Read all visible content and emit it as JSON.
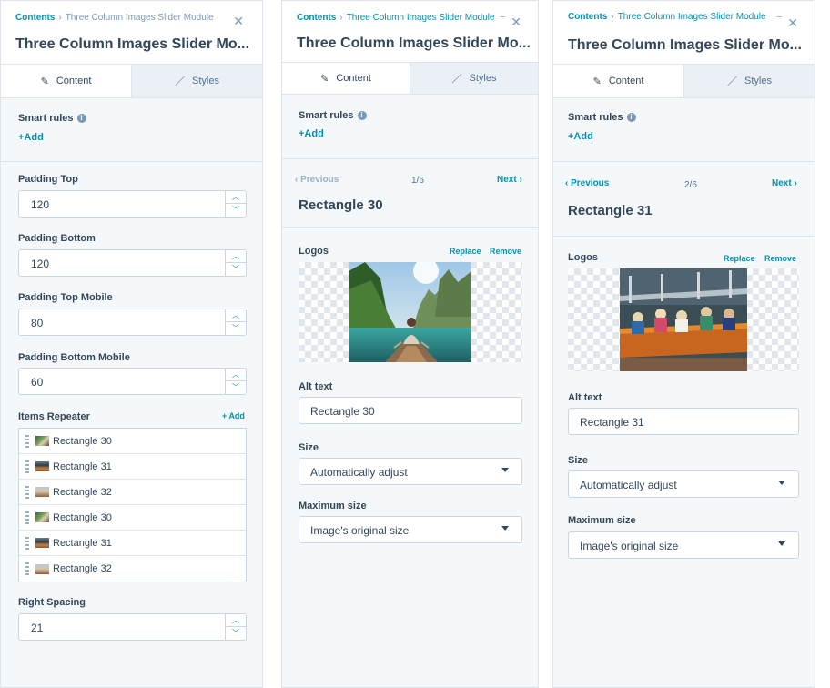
{
  "breadcrumb": {
    "root": "Contents",
    "current": "Three Column Images Slider Module"
  },
  "module_title": "Three Column Images Slider Mo...",
  "tabs": {
    "content": "Content",
    "styles": "Styles"
  },
  "smart_rules": {
    "label": "Smart rules",
    "add": "+Add"
  },
  "fields": [
    {
      "label": "Padding Top",
      "value": "120"
    },
    {
      "label": "Padding Bottom",
      "value": "120"
    },
    {
      "label": "Padding Top Mobile",
      "value": "80"
    },
    {
      "label": "Padding Bottom Mobile",
      "value": "60"
    }
  ],
  "items_repeater": {
    "label": "Items Repeater",
    "add": "+ Add",
    "items": [
      "Rectangle 30",
      "Rectangle 31",
      "Rectangle 32",
      "Rectangle 30",
      "Rectangle 31",
      "Rectangle 32"
    ]
  },
  "right_spacing": {
    "label": "Right Spacing",
    "value": "21"
  },
  "nav": {
    "previous": "Previous",
    "next": "Next"
  },
  "image_editors": [
    {
      "count": "1/6",
      "title": "Rectangle 30",
      "logos_label": "Logos",
      "replace": "Replace",
      "remove": "Remove",
      "alt_label": "Alt text",
      "alt_value": "Rectangle 30",
      "size_label": "Size",
      "size_value": "Automatically adjust",
      "max_label": "Maximum size",
      "max_value": "Image's original size"
    },
    {
      "count": "2/6",
      "title": "Rectangle 31",
      "logos_label": "Logos",
      "replace": "Replace",
      "remove": "Remove",
      "alt_label": "Alt text",
      "alt_value": "Rectangle 31",
      "size_label": "Size",
      "size_value": "Automatically adjust",
      "max_label": "Maximum size",
      "max_value": "Image's original size"
    }
  ],
  "icons": [
    "pencil-icon",
    "brush-icon",
    "info-icon",
    "close-icon",
    "chevron-down-icon",
    "chevron-left-icon",
    "chevron-right-icon",
    "drag-handle-icon"
  ],
  "colors": {
    "accent": "#0091ae",
    "text": "#33475b",
    "panel_bg": "#f5f8fa",
    "border": "#cbd6e2"
  }
}
